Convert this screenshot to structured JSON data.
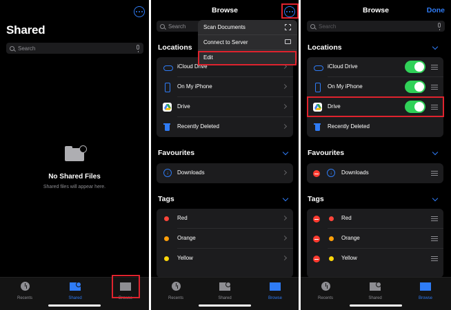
{
  "panel1": {
    "title": "Shared",
    "search_placeholder": "Search",
    "empty_title": "No Shared Files",
    "empty_subtitle": "Shared files will appear here."
  },
  "panel2": {
    "nav_title": "Browse",
    "search_placeholder": "Search",
    "menu": [
      {
        "label": "Scan Documents",
        "icon": "scan-icon"
      },
      {
        "label": "Connect to Server",
        "icon": "monitor-icon"
      },
      {
        "label": "Edit"
      }
    ],
    "sections": {
      "locations": "Locations",
      "favourites": "Favourites",
      "tags": "Tags"
    },
    "locations": [
      "iCloud Drive",
      "On My iPhone",
      "Drive",
      "Recently Deleted"
    ],
    "favourites": [
      "Downloads"
    ],
    "tags": [
      {
        "label": "Red",
        "color": "#ff453a"
      },
      {
        "label": "Orange",
        "color": "#ff9f0a"
      },
      {
        "label": "Yellow",
        "color": "#ffd60a"
      }
    ]
  },
  "panel3": {
    "nav_title": "Browse",
    "done_label": "Done",
    "search_placeholder": "Search",
    "sections": {
      "locations": "Locations",
      "favourites": "Favourites",
      "tags": "Tags"
    },
    "locations": [
      "iCloud Drive",
      "On My iPhone",
      "Drive",
      "Recently Deleted"
    ],
    "favourites": [
      "Downloads"
    ],
    "tags": [
      {
        "label": "Red",
        "color": "#ff453a"
      },
      {
        "label": "Orange",
        "color": "#ff9f0a"
      },
      {
        "label": "Yellow",
        "color": "#ffd60a"
      }
    ]
  },
  "tabbar": {
    "recents": "Recents",
    "shared": "Shared",
    "browse": "Browse"
  },
  "colors": {
    "accent": "#2f7cf6",
    "highlight": "#e0232e",
    "toggle_on": "#30d158",
    "delete": "#ff3b30"
  }
}
